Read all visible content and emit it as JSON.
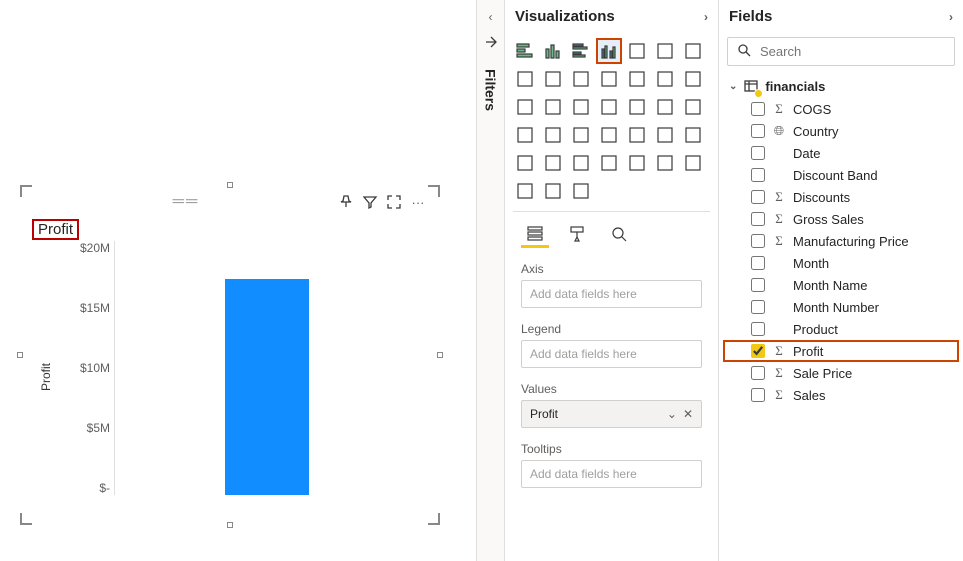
{
  "canvas": {
    "visual_title": "Profit",
    "header_icons": [
      "pin",
      "filter",
      "focus",
      "more"
    ]
  },
  "chart_data": {
    "type": "bar",
    "title": "Profit",
    "ylabel": "Profit",
    "y_ticks": [
      "$20M",
      "$15M",
      "$10M",
      "$5M",
      "$-"
    ],
    "categories": [
      ""
    ],
    "values": [
      17000000
    ],
    "ylim": [
      0,
      20000000
    ]
  },
  "filters": {
    "label": "Filters"
  },
  "viz_pane": {
    "title": "Visualizations",
    "icons": [
      "stacked-bar",
      "stacked-column",
      "clustered-bar",
      "clustered-column",
      "100-stacked-bar",
      "100-stacked-column",
      "line",
      "area",
      "stacked-area",
      "line-stacked-column",
      "line-clustered-column",
      "ribbon",
      "waterfall",
      "funnel",
      "scatter",
      "pie",
      "donut",
      "treemap",
      "map",
      "filled-map",
      "shape-map",
      "gauge",
      "card",
      "multi-row-card",
      "kpi",
      "slicer",
      "table",
      "matrix",
      "r-visual",
      "python-visual",
      "key-influencers",
      "decomposition-tree",
      "qna",
      "paginated",
      "custom1",
      "custom2",
      "custom3",
      "more"
    ],
    "selected_index": 3,
    "format_tabs": [
      "fields",
      "format",
      "analytics"
    ],
    "wells": {
      "axis": {
        "label": "Axis",
        "placeholder": "Add data fields here"
      },
      "legend": {
        "label": "Legend",
        "placeholder": "Add data fields here"
      },
      "values": {
        "label": "Values",
        "value": "Profit"
      },
      "tooltips": {
        "label": "Tooltips",
        "placeholder": "Add data fields here"
      }
    }
  },
  "fields_pane": {
    "title": "Fields",
    "search_placeholder": "Search",
    "tables": [
      {
        "name": "financials",
        "expanded": true,
        "fields": [
          {
            "name": "COGS",
            "type": "sum",
            "checked": false
          },
          {
            "name": "Country",
            "type": "geo",
            "checked": false
          },
          {
            "name": "Date",
            "type": "",
            "checked": false
          },
          {
            "name": "Discount Band",
            "type": "",
            "checked": false
          },
          {
            "name": "Discounts",
            "type": "sum",
            "checked": false
          },
          {
            "name": "Gross Sales",
            "type": "sum",
            "checked": false
          },
          {
            "name": "Manufacturing Price",
            "type": "sum",
            "checked": false
          },
          {
            "name": "Month",
            "type": "",
            "checked": false
          },
          {
            "name": "Month Name",
            "type": "",
            "checked": false
          },
          {
            "name": "Month Number",
            "type": "",
            "checked": false
          },
          {
            "name": "Product",
            "type": "",
            "checked": false
          },
          {
            "name": "Profit",
            "type": "sum",
            "checked": true,
            "highlighted": true
          },
          {
            "name": "Sale Price",
            "type": "sum",
            "checked": false
          },
          {
            "name": "Sales",
            "type": "sum",
            "checked": false
          }
        ]
      }
    ]
  }
}
